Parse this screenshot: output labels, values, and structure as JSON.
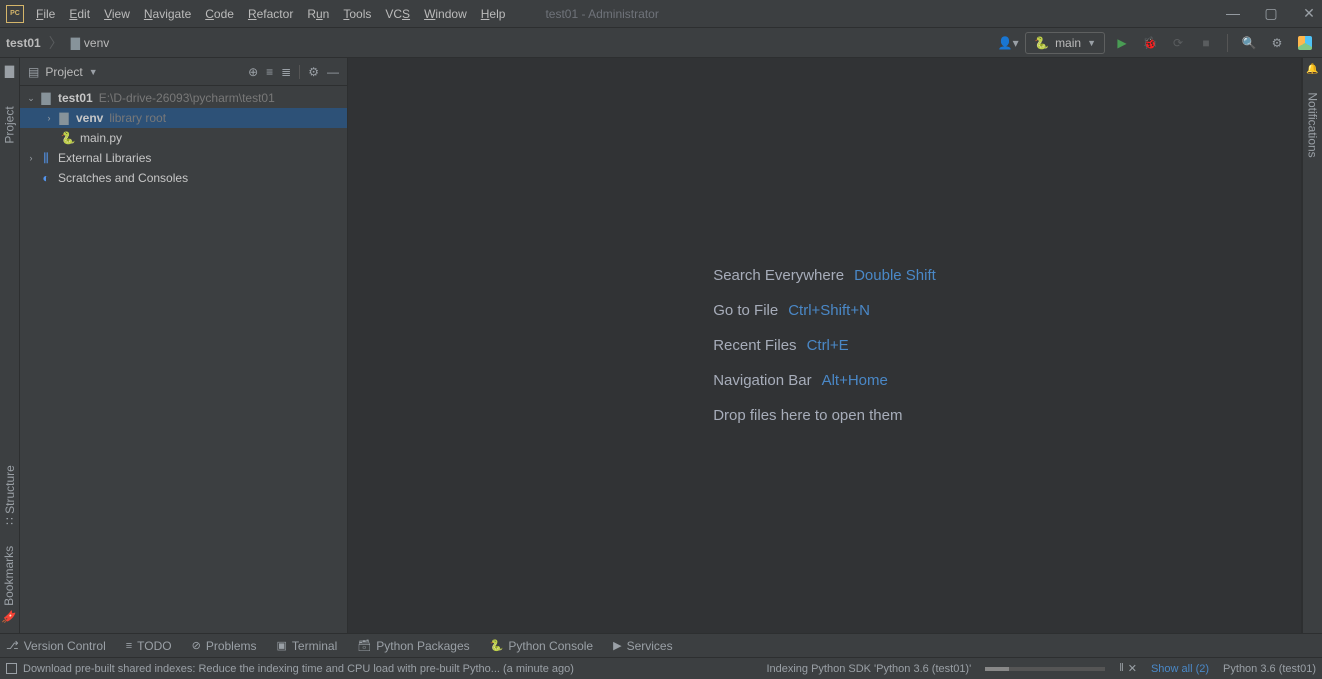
{
  "window": {
    "title": "test01 - Administrator"
  },
  "menu": {
    "items": [
      "File",
      "Edit",
      "View",
      "Navigate",
      "Code",
      "Refactor",
      "Run",
      "Tools",
      "VCS",
      "Window",
      "Help"
    ]
  },
  "breadcrumb": {
    "root": "test01",
    "child": "venv"
  },
  "run_config": {
    "name": "main"
  },
  "gutters": {
    "project": "Project",
    "structure": "Structure",
    "bookmarks": "Bookmarks",
    "notifications": "Notifications"
  },
  "project_panel": {
    "title": "Project"
  },
  "tree": {
    "root": {
      "name": "test01",
      "path": "E:\\D-drive-26093\\pycharm\\test01"
    },
    "venv": {
      "name": "venv",
      "hint": "library root"
    },
    "main": {
      "name": "main.py"
    },
    "ext_libs": {
      "name": "External Libraries"
    },
    "scratches": {
      "name": "Scratches and Consoles"
    }
  },
  "editor": {
    "hints": [
      {
        "label": "Search Everywhere",
        "key": "Double Shift"
      },
      {
        "label": "Go to File",
        "key": "Ctrl+Shift+N"
      },
      {
        "label": "Recent Files",
        "key": "Ctrl+E"
      },
      {
        "label": "Navigation Bar",
        "key": "Alt+Home"
      }
    ],
    "drop": "Drop files here to open them"
  },
  "tool_windows": {
    "items": [
      "Version Control",
      "TODO",
      "Problems",
      "Terminal",
      "Python Packages",
      "Python Console",
      "Services"
    ]
  },
  "status": {
    "message": "Download pre-built shared indexes: Reduce the indexing time and CPU load with pre-built Pytho... (a minute ago)",
    "indexing": "Indexing Python SDK 'Python 3.6 (test01)'",
    "show_all": "Show all (2)",
    "interpreter": "Python 3.6 (test01)"
  }
}
